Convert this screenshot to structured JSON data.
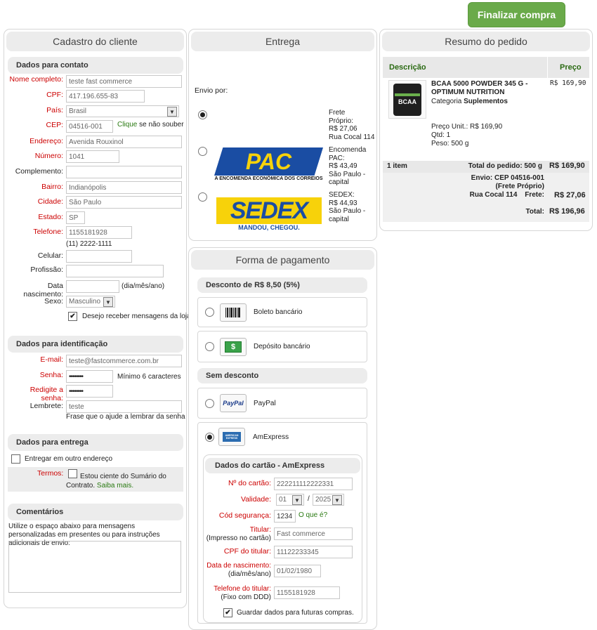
{
  "finalize_button": "Finalizar compra",
  "customer": {
    "title": "Cadastro do cliente",
    "contact_section": "Dados para contato",
    "fields": {
      "nome_label": "Nome completo:",
      "nome_value": "teste fast commerce",
      "cpf_label": "CPF:",
      "cpf_value": "417.196.655-83",
      "pais_label": "País:",
      "pais_value": "Brasil",
      "cep_label": "CEP:",
      "cep_value": "04516-001",
      "cep_link": "Clique",
      "cep_hint": "se não souber",
      "endereco_label": "Endereço:",
      "endereco_value": "Avenida Rouxinol",
      "numero_label": "Número:",
      "numero_value": "1041",
      "complemento_label": "Complemento:",
      "complemento_value": "",
      "bairro_label": "Bairro:",
      "bairro_value": "Indianópolis",
      "cidade_label": "Cidade:",
      "cidade_value": "São Paulo",
      "estado_label": "Estado:",
      "estado_value": "SP",
      "telefone_label": "Telefone:",
      "telefone_value": "1155181928",
      "telefone_formatted": "(11) 2222-1111",
      "celular_label": "Celular:",
      "celular_value": "",
      "profissao_label": "Profissão:",
      "profissao_value": "",
      "nascimento_label": "Data nascimento:",
      "nascimento_value": "",
      "nascimento_hint": "(dia/mês/ano)",
      "sexo_label": "Sexo:",
      "sexo_value": "Masculino",
      "newsletter_label": "Desejo receber mensagens da loja"
    },
    "id_section": "Dados para identificação",
    "id_fields": {
      "email_label": "E-mail:",
      "email_value": "teste@fastcommerce.com.br",
      "senha_label": "Senha:",
      "senha_value": "••••••••",
      "senha_hint": "Mínimo 6 caracteres",
      "redigite_label": "Redigite a senha:",
      "redigite_value": "••••••••",
      "lembrete_label": "Lembrete:",
      "lembrete_value": "teste",
      "lembrete_hint": "Frase que o ajude a lembrar da senha"
    },
    "delivery_section": "Dados para entrega",
    "other_address_label": "Entregar em outro endereço",
    "terms_label": "Termos:",
    "terms_text": "Estou ciente do Sumário do Contrato.",
    "terms_link": "Saiba mais.",
    "comments_section": "Comentários",
    "comments_hint": "Utilize o espaço abaixo para mensagens personalizadas em presentes ou para instruções adicionais de envio:"
  },
  "delivery": {
    "title": "Entrega",
    "envio_label": "Envio por:",
    "options": [
      {
        "line1": "Frete",
        "line2": "Próprio:",
        "price": "R$ 27,06",
        "extra": "Rua Cocal 114"
      },
      {
        "line1": "Encomenda",
        "line2": "PAC:",
        "price": "R$ 43,49",
        "extra": "São Paulo - capital"
      },
      {
        "line1": "SEDEX:",
        "line2": "",
        "price": "R$ 44,93",
        "extra": "São Paulo - capital"
      }
    ],
    "pac_logo": "PAC",
    "pac_tagline": "A ENCOMENDA ECONÔMICA DOS CORREIOS",
    "sedex_logo": "SEDEX",
    "sedex_tagline": "MANDOU, CHEGOU."
  },
  "payment": {
    "title": "Forma de pagamento",
    "discount_section": "Desconto de R$ 8,50 (5%)",
    "boleto": "Boleto bancário",
    "deposito": "Depósito bancário",
    "no_discount_section": "Sem desconto",
    "paypal": "PayPal",
    "paypal_icon_text": "PayPal",
    "amex": "AmExpress",
    "amex_icon_text": "AMERICAN EXPRESS",
    "card_section": "Dados do cartão - AmExpress",
    "card": {
      "numero_label": "Nº do cartão:",
      "numero_value": "222211112222331",
      "validade_label": "Validade:",
      "mes": "01",
      "ano": "2025",
      "cod_label": "Cód segurança:",
      "cod_value": "1234",
      "cod_link": "O que é?",
      "titular_label": "Titular:",
      "titular_sub": "(Impresso no cartão)",
      "titular_value": "Fast commerce",
      "cpf_label": "CPF do titular:",
      "cpf_value": "11122233345",
      "nasc_label": "Data de nascimento:",
      "nasc_sub": "(dia/mês/ano)",
      "nasc_value": "01/02/1980",
      "tel_label": "Telefone do titular:",
      "tel_sub": "(Fixo com DDD)",
      "tel_value": "1155181928",
      "save_label": "Guardar dados para futuras compras."
    }
  },
  "summary": {
    "title": "Resumo do pedido",
    "col_desc": "Descrição",
    "col_price": "Preço",
    "product_name": "BCAA 5000 POWDER 345 G - OPTIMUM NUTRITION",
    "category_label": "Categoria",
    "category_value": "Suplementos",
    "unit_price": "Preço Unit.: R$ 169,90",
    "qty": "Qtd: 1",
    "weight": "Peso: 500 g",
    "price": "R$ 169,90",
    "image_text": "BCAA",
    "items_count": "1 item",
    "total_order_label": "Total do pedido: 500 g",
    "total_order_value": "R$ 169,90",
    "shipping_line1": "Envio: CEP 04516-001",
    "shipping_line2": "(Frete Próprio)",
    "shipping_line3": "Rua Cocal 114",
    "frete_label": "Frete:",
    "frete_value": "R$ 27,06",
    "total_label": "Total:",
    "total_value": "R$ 196,96"
  }
}
